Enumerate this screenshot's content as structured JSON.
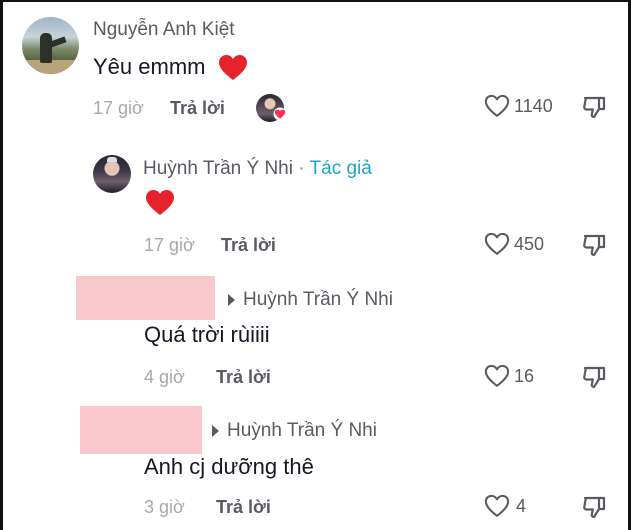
{
  "comments": [
    {
      "author": "Nguyễn Anh Kiệt",
      "text": "Yêu emmm",
      "time": "17 giờ",
      "reply_label": "Trả lời",
      "likes": "1140"
    }
  ],
  "reply1": {
    "author": "Huỳnh Trần Ý Nhi",
    "separator": "·",
    "author_tag": "Tác giả",
    "time": "17 giờ",
    "reply_label": "Trả lời",
    "likes": "450"
  },
  "reply2": {
    "reply_to": "Huỳnh Trần Ý Nhi",
    "text": "Quá trời rùiiii",
    "time": "4 giờ",
    "reply_label": "Trả lời",
    "likes": "16"
  },
  "reply3": {
    "reply_to": "Huỳnh Trần Ý Nhi",
    "text": "Anh cj dưỡng thê",
    "time": "3 giờ",
    "reply_label": "Trả lời",
    "likes": "4"
  },
  "colors": {
    "heart_emoji": "#e8222b",
    "author_tag": "#20a5c2",
    "redaction": "#f8c8cc"
  },
  "icons": [
    "heart-outline-icon",
    "dislike-icon",
    "heart-emoji-icon",
    "reply-arrow-icon"
  ]
}
